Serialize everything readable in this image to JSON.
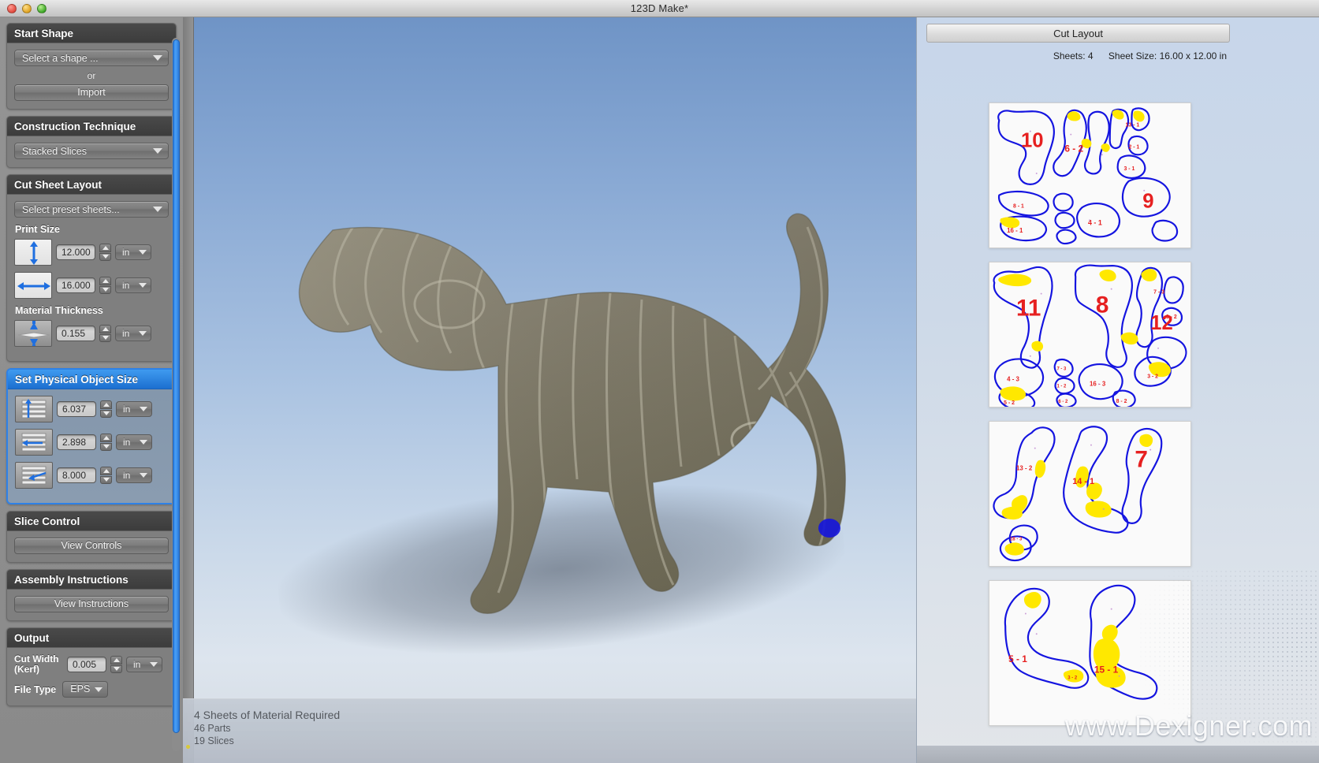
{
  "window": {
    "title": "123D Make*",
    "controls": [
      "close",
      "minimize",
      "zoom"
    ]
  },
  "sidebar": {
    "panels": [
      {
        "title": "Start Shape",
        "shape_select": "Select a shape ...",
        "or_label": "or",
        "import_label": "Import"
      },
      {
        "title": "Construction Technique",
        "technique_select": "Stacked Slices"
      },
      {
        "title": "Cut Sheet Layout",
        "preset_select": "Select preset sheets...",
        "print_size_label": "Print Size",
        "height_value": "12.000",
        "height_unit": "in",
        "width_value": "16.000",
        "width_unit": "in",
        "material_thickness_label": "Material Thickness",
        "thickness_value": "0.155",
        "thickness_unit": "in"
      },
      {
        "title": "Set Physical Object Size",
        "selected": true,
        "height_value": "6.037",
        "height_unit": "in",
        "width_value": "2.898",
        "width_unit": "in",
        "depth_value": "8.000",
        "depth_unit": "in"
      },
      {
        "title": "Slice Control",
        "button_label": "View Controls"
      },
      {
        "title": "Assembly Instructions",
        "button_label": "View Instructions"
      },
      {
        "title": "Output",
        "kerf_label_line1": "Cut Width",
        "kerf_label_line2": "(Kerf)",
        "kerf_value": "0.005",
        "kerf_unit": "in",
        "file_type_label": "File Type",
        "file_type_value": "EPS"
      }
    ]
  },
  "viewport": {
    "status": {
      "line1": "4 Sheets of Material Required",
      "line2": "46 Parts",
      "line3": "19 Slices"
    }
  },
  "right_panel": {
    "tab_label": "Cut Layout",
    "sheets_label": "Sheets: 4",
    "sheet_size_label": "Sheet Size: 16.00 x 12.00 in",
    "watermark": "www.Dexigner.com",
    "sheet_parts": [
      [
        "10",
        "6 - 2",
        "9",
        "13 - 1",
        "3 - 1",
        "2 - 1",
        "16 - 1",
        "4 - 1",
        "8 - 1"
      ],
      [
        "11",
        "8",
        "12",
        "4 - 3",
        "16 - 3",
        "7 - 3",
        "1 - 2",
        "6 - 2",
        "5 - 2"
      ],
      [
        "13 - 2",
        "14 - 1",
        "7",
        "18 - 3"
      ],
      [
        "5 - 1",
        "15 - 1",
        "3 - 2"
      ]
    ]
  },
  "colors": {
    "accent": "#2f81e6",
    "part_outline": "#1414e0",
    "part_label": "#e62020",
    "part_highlight": "#ffe800",
    "sheet_bg": "#fafafa",
    "panel_header": "#3c3c3c",
    "viewport_sky": "#89a9d4",
    "model_body": "#7e7a6b"
  }
}
